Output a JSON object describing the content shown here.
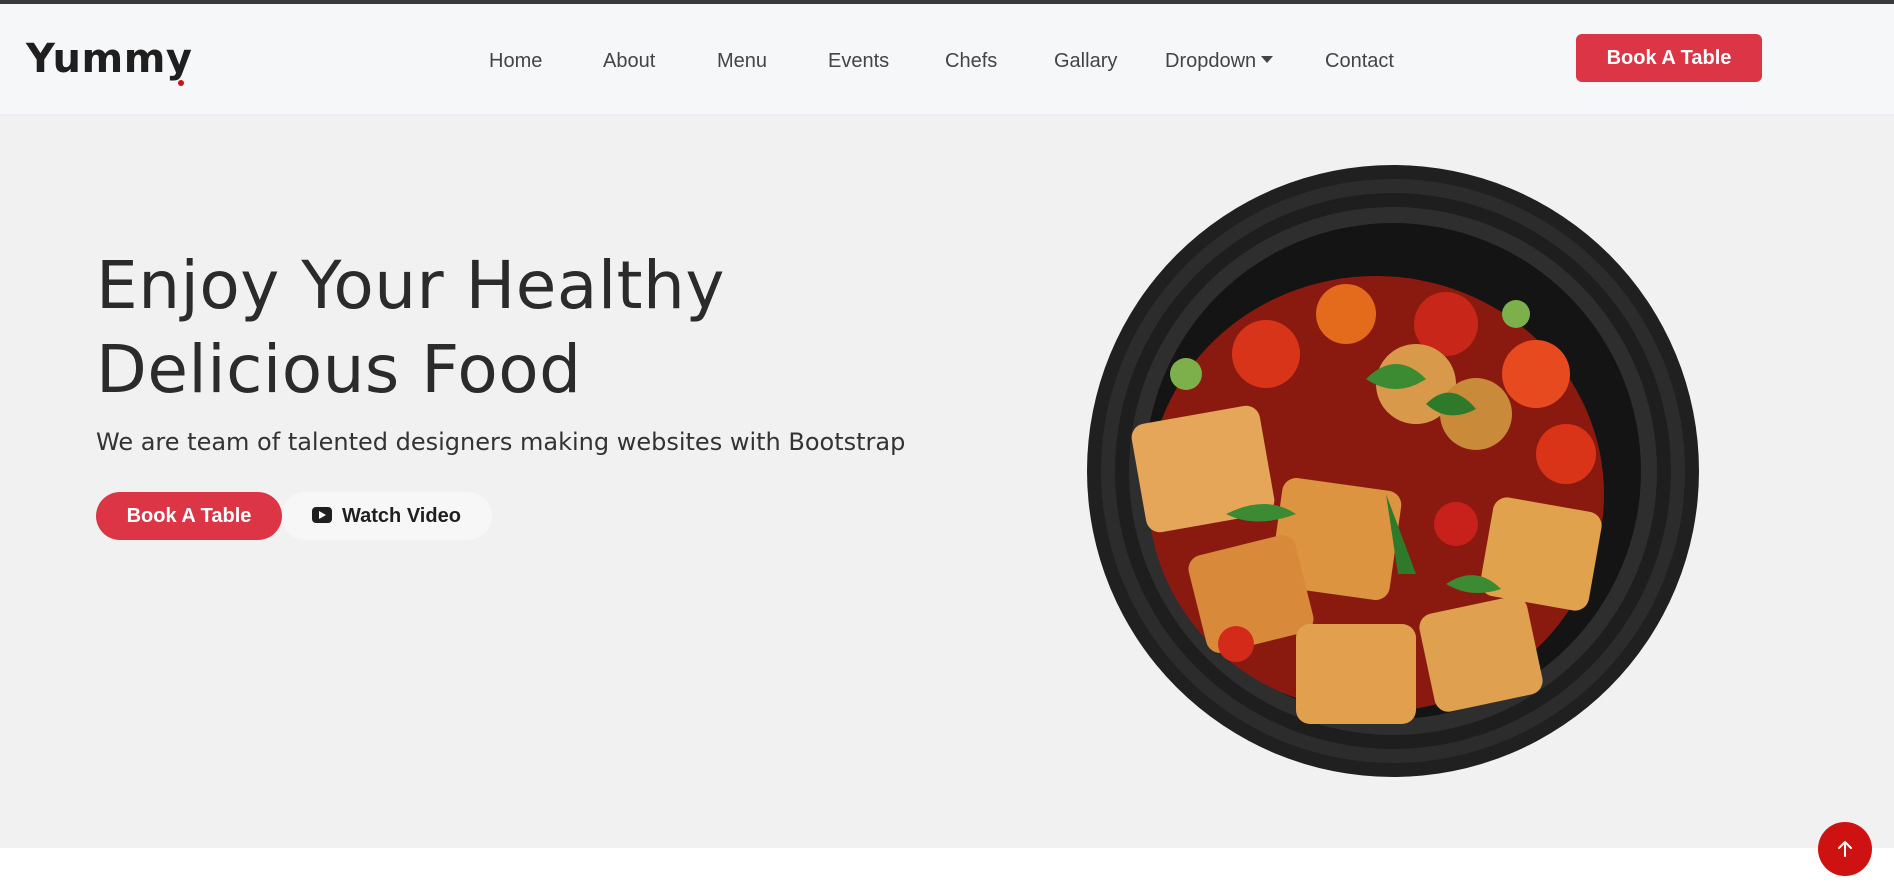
{
  "brand": {
    "name": "Yummy",
    "accent_color": "#ce1212"
  },
  "nav": {
    "items": [
      {
        "label": "Home"
      },
      {
        "label": "About"
      },
      {
        "label": "Menu"
      },
      {
        "label": "Events"
      },
      {
        "label": "Chefs"
      },
      {
        "label": "Gallary"
      },
      {
        "label": "Dropdown",
        "icon": "caret-down-icon"
      },
      {
        "label": "Contact"
      }
    ]
  },
  "header": {
    "cta_label": "Book A Table",
    "cta_color": "#dc3545"
  },
  "hero": {
    "title_line1": "Enjoy Your Healthy",
    "title_line2": "Delicious Food",
    "subtitle": "We are team of talented designers making websites with Bootstrap",
    "primary_cta": "Book A Table",
    "secondary_cta": "Watch Video",
    "secondary_icon": "youtube-play-icon",
    "image_icon": "food-bowl-image"
  },
  "scroll_top": {
    "icon": "arrow-up-icon"
  }
}
